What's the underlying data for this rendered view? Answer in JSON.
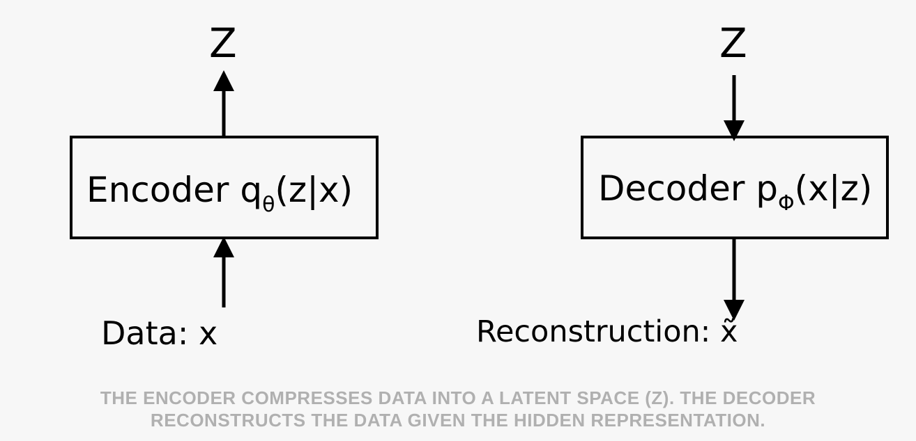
{
  "encoder": {
    "latent_label": "Z",
    "box_main": "Encoder q",
    "box_sub": "θ",
    "box_tail": "(z|x)",
    "input_label": "Data: x"
  },
  "decoder": {
    "latent_label": "Z",
    "box_main": "Decoder p",
    "box_sub": "Φ",
    "box_tail": "(x|z)",
    "output_label": "Reconstruction: x̃"
  },
  "caption": {
    "line1": "THE ENCODER COMPRESSES DATA INTO A LATENT SPACE (Z). THE DECODER",
    "line2": "RECONSTRUCTS THE DATA GIVEN THE HIDDEN REPRESENTATION."
  },
  "colors": {
    "background": "#f7f7f7",
    "ink": "#000000",
    "caption": "#b0b0b0"
  }
}
